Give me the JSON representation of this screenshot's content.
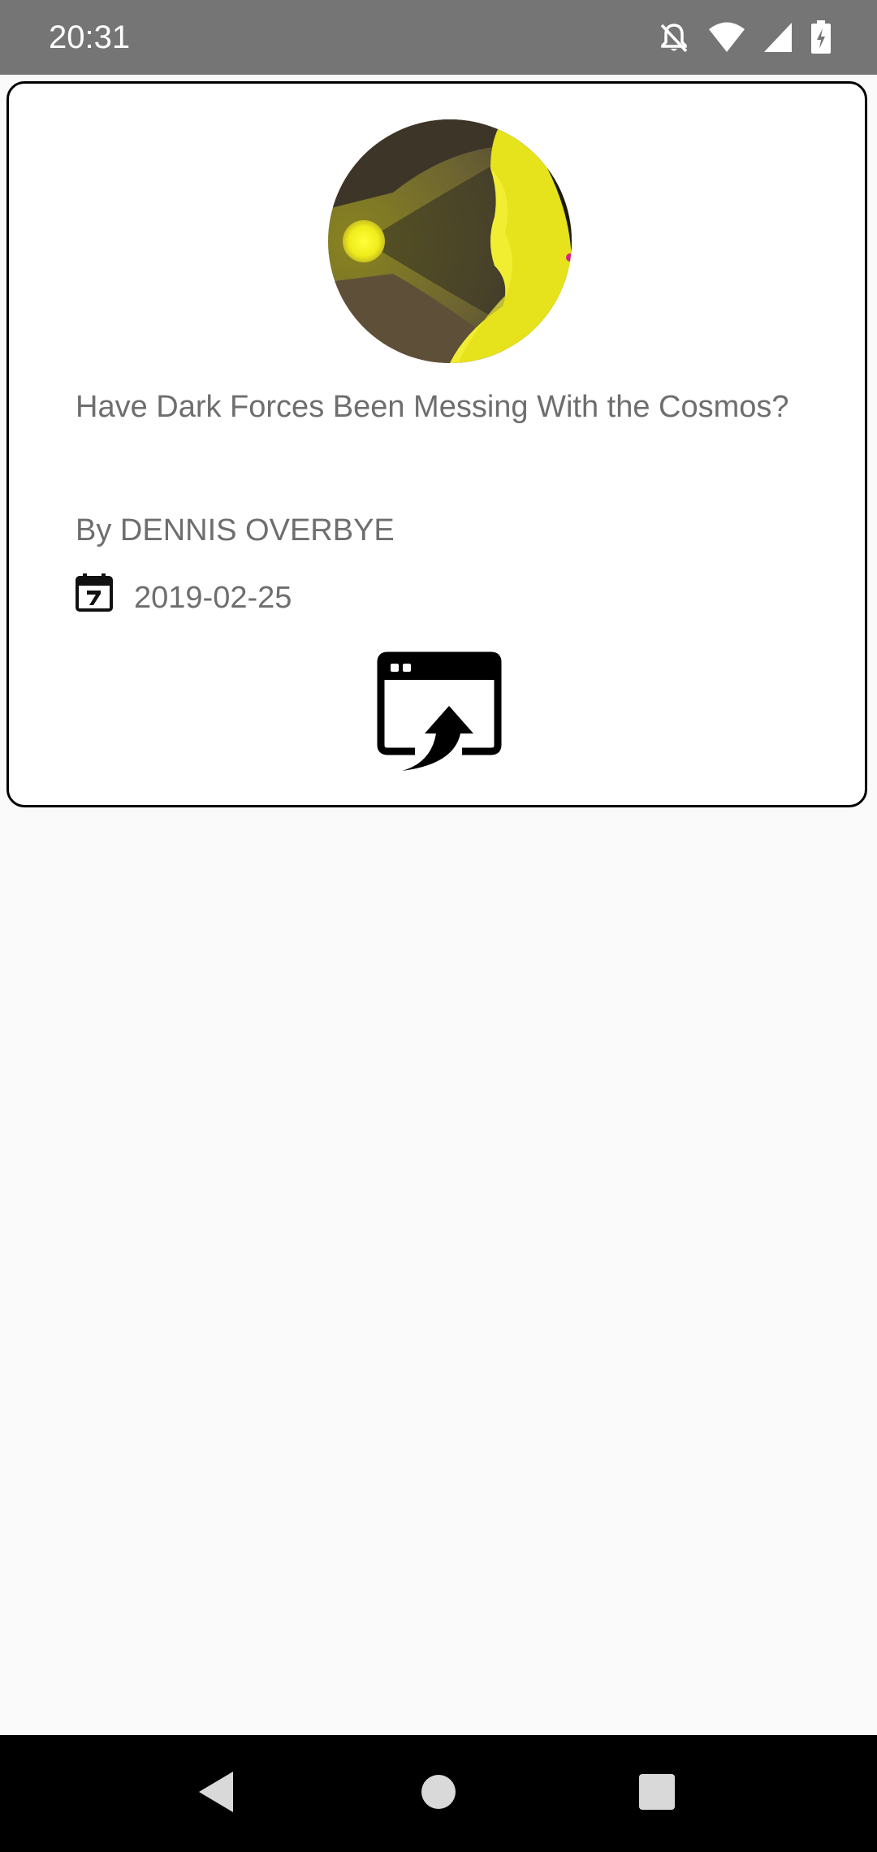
{
  "status_bar": {
    "time": "20:31",
    "icons": [
      "notifications-off-icon",
      "wifi-icon",
      "signal-icon",
      "battery-charging-icon"
    ]
  },
  "article": {
    "image_icon": "article-thumbnail",
    "headline": "Have Dark Forces Been Messing With the Cosmos?",
    "byline": "By DENNIS OVERBYE",
    "date_icon": "calendar-icon",
    "date": "2019-02-25",
    "open_icon": "open-in-browser-icon"
  },
  "nav_bar": {
    "buttons": [
      "back-icon",
      "home-icon",
      "recents-icon"
    ]
  },
  "colors": {
    "status_bar_bg": "#757575",
    "page_bg": "#fafafa",
    "card_border": "#000000",
    "text": "#6e6e6e",
    "nav_bar_bg": "#000000"
  }
}
